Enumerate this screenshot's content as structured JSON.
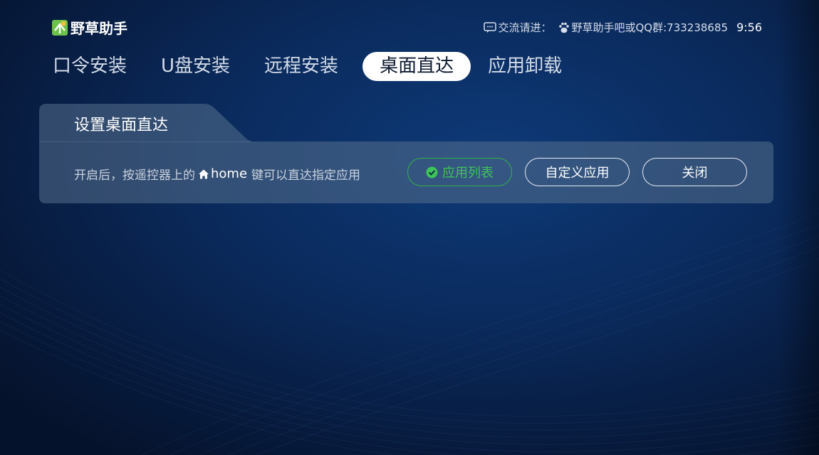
{
  "app": {
    "name": "野草助手"
  },
  "header": {
    "contact_label": "交流请进：",
    "contact_value": "野草助手吧或QQ群:733238685",
    "time": "9:56"
  },
  "tabs": [
    {
      "label": "口令安装",
      "active": false
    },
    {
      "label": "U盘安装",
      "active": false
    },
    {
      "label": "远程安装",
      "active": false
    },
    {
      "label": "桌面直达",
      "active": true
    },
    {
      "label": "应用卸载",
      "active": false
    }
  ],
  "panel": {
    "title": "设置桌面直达",
    "desc_before": "开启后，按遥控器上的",
    "desc_key": "home",
    "desc_after": "键可以直达指定应用",
    "buttons": {
      "apps": "应用列表",
      "custom": "自定义应用",
      "close": "关闭"
    }
  },
  "colors": {
    "accent_green": "#3ec457",
    "background": "#0a2a5c"
  }
}
